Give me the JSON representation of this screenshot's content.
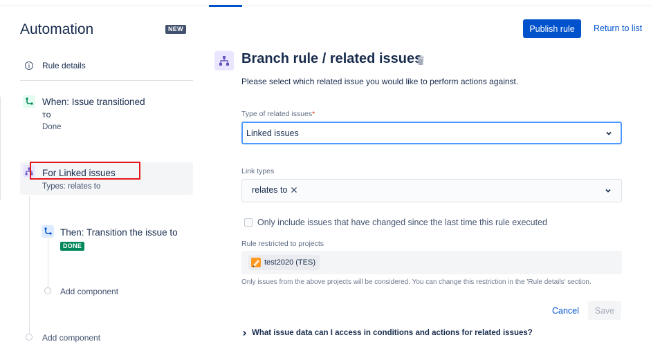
{
  "app": {
    "title": "Automation",
    "new_badge": "NEW"
  },
  "sidebar": {
    "rule_details": {
      "label": "Rule details",
      "icon": "info-icon"
    },
    "components": [
      {
        "kind": "trigger",
        "icon": "trigger-icon",
        "title": "When: Issue transitioned",
        "to_label": "TO",
        "status": "Done"
      },
      {
        "kind": "branch",
        "icon": "branch-icon",
        "title": "For Linked issues",
        "subtitle": "Types: relates to"
      },
      {
        "kind": "action",
        "icon": "action-icon",
        "title": "Then: Transition the issue to",
        "status_lozenge": "DONE"
      }
    ],
    "add_component_inner": "Add component",
    "add_component_outer": "Add component"
  },
  "header": {
    "publish_label": "Publish rule",
    "return_label": "Return to list"
  },
  "detail": {
    "title": "Branch rule / related issues",
    "description": "Please select which related issue you would like to perform actions against.",
    "type_field": {
      "label": "Type of related issues",
      "required_mark": "*",
      "value": "Linked issues"
    },
    "link_types": {
      "label": "Link types",
      "tags": [
        "relates to"
      ]
    },
    "checkbox": {
      "label": "Only include issues that have changed since the last time this rule executed",
      "checked": false
    },
    "projects": {
      "label": "Rule restricted to projects",
      "items": [
        "test2020 (TES)"
      ]
    },
    "helper_text": "Only issues from the above projects will be considered. You can change this restriction in the 'Rule details' section.",
    "cancel_label": "Cancel",
    "save_label": "Save",
    "faq": "What issue data can I access in conditions and actions for related issues?"
  },
  "colors": {
    "primary": "#0052cc",
    "highlight": "#e5161b",
    "done_green": "#00875a",
    "focus_ring": "#4c9aff"
  }
}
